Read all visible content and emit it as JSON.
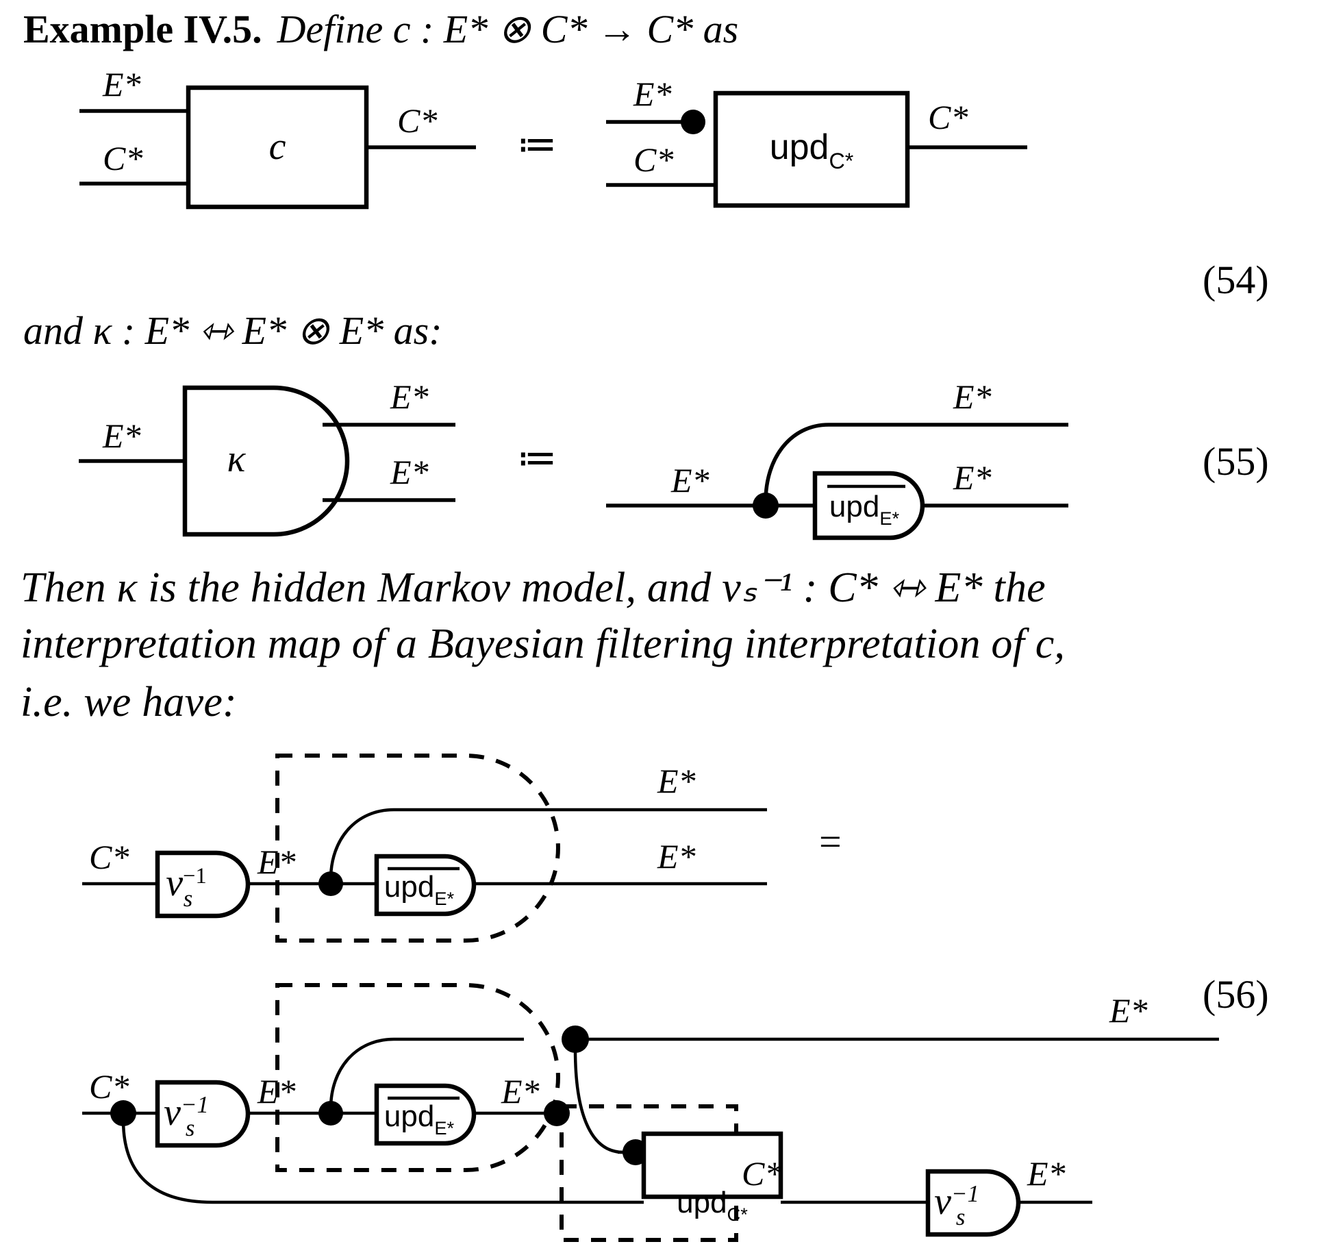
{
  "document": {
    "heading": "Example IV.5.",
    "intro_math": "Define c : E* ⊗ C* → C* as",
    "mid_math": "and κ : E* ⇿ E* ⊗ E* as:",
    "paragraph_line1": "Then κ is the hidden Markov model, and νₛ⁻¹ : C* ⇿ E* the",
    "paragraph_line2": "interpretation map of a Bayesian filtering interpretation of c,",
    "paragraph_line3": "i.e. we have:"
  },
  "equation_numbers": {
    "eq54": "(54)",
    "eq55": "(55)",
    "eq56": "(56)"
  },
  "symbols": {
    "def_equals": "≔",
    "equals": "=",
    "tensor": "⊗",
    "arrow": "→",
    "kleisli_arrow": "⇿",
    "star": "*",
    "E_star": "E*",
    "C_star": "C*"
  },
  "eq54": {
    "lhs": {
      "box_label": "c",
      "inputs": [
        {
          "label": "E*"
        },
        {
          "label": "C*"
        }
      ],
      "outputs": [
        {
          "label": "C*"
        }
      ]
    },
    "rhs": {
      "box_label": "upd",
      "box_subscript": "C*",
      "inputs": [
        {
          "label": "E*",
          "has_dot": true
        },
        {
          "label": "C*",
          "has_dot": false
        }
      ],
      "outputs": [
        {
          "label": "C*"
        }
      ]
    }
  },
  "eq55": {
    "lhs": {
      "box_label": "κ",
      "inputs": [
        {
          "label": "E*"
        }
      ],
      "outputs": [
        {
          "label": "E*"
        },
        {
          "label": "E*"
        }
      ]
    },
    "rhs": {
      "box_label": "upd",
      "box_subscript": "E*",
      "box_has_overline": true,
      "inputs": [
        {
          "label": "E*",
          "has_dot": true
        }
      ],
      "outputs": [
        {
          "label": "E*"
        },
        {
          "label": "E*"
        }
      ]
    }
  },
  "eq56": {
    "top": {
      "input_label": "C*",
      "nu_label": "ν",
      "nu_sub": "s",
      "nu_sup": "−1",
      "wire_after_nu_label": "E*",
      "upd_label": "upd",
      "upd_subscript": "E*",
      "upd_has_overline": true,
      "outputs": [
        {
          "label": "E*"
        },
        {
          "label": "E*"
        }
      ],
      "dashed_group": true
    },
    "bottom": {
      "input_label": "C*",
      "nu_label": "ν",
      "nu_sub": "s",
      "nu_sup": "−1",
      "wire_after_nu_label": "E*",
      "upd_e_label": "upd",
      "upd_e_subscript": "E*",
      "upd_e_has_overline": true,
      "mid_label": "E*",
      "upd_c_label": "upd",
      "upd_c_subscript": "C*",
      "after_upd_c_label": "C*",
      "nu2_label": "ν",
      "nu2_sub": "s",
      "nu2_sup": "−1",
      "outputs": [
        {
          "label": "E*"
        },
        {
          "label": "E*"
        }
      ],
      "dashed_groups": 2
    }
  },
  "colors": {
    "ink": "#000000",
    "paper": "#ffffff"
  }
}
